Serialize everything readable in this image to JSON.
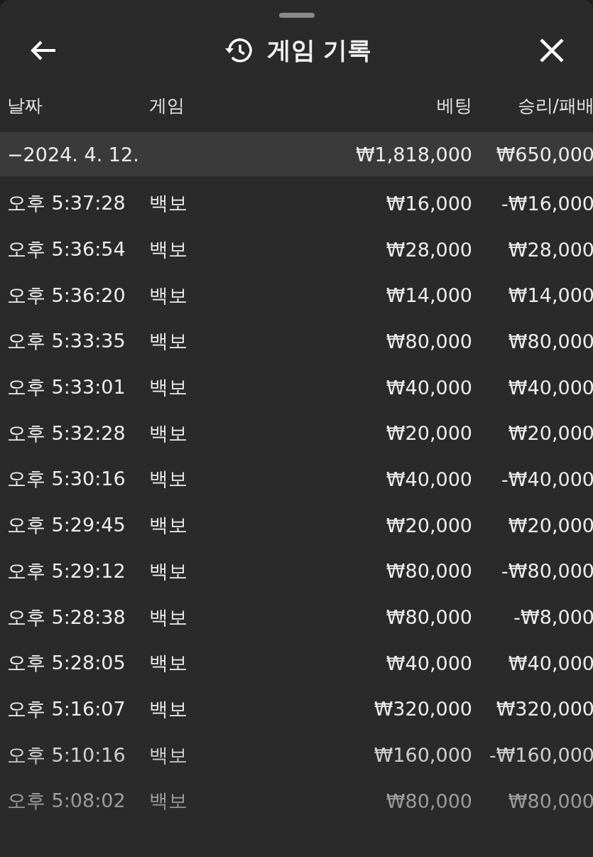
{
  "header": {
    "title": "게임 기록"
  },
  "columns": [
    "날짜",
    "게임",
    "베팅",
    "승리/패배"
  ],
  "group": {
    "toggle": "−",
    "date": "2024. 4. 12.",
    "bet": "₩1,818,000",
    "result": "₩650,000"
  },
  "rows": [
    {
      "time": "오후 5:37:28",
      "game": "백보",
      "bet": "₩16,000",
      "result": "-₩16,000"
    },
    {
      "time": "오후 5:36:54",
      "game": "백보",
      "bet": "₩28,000",
      "result": "₩28,000"
    },
    {
      "time": "오후 5:36:20",
      "game": "백보",
      "bet": "₩14,000",
      "result": "₩14,000"
    },
    {
      "time": "오후 5:33:35",
      "game": "백보",
      "bet": "₩80,000",
      "result": "₩80,000"
    },
    {
      "time": "오후 5:33:01",
      "game": "백보",
      "bet": "₩40,000",
      "result": "₩40,000"
    },
    {
      "time": "오후 5:32:28",
      "game": "백보",
      "bet": "₩20,000",
      "result": "₩20,000"
    },
    {
      "time": "오후 5:30:16",
      "game": "백보",
      "bet": "₩40,000",
      "result": "-₩40,000"
    },
    {
      "time": "오후 5:29:45",
      "game": "백보",
      "bet": "₩20,000",
      "result": "₩20,000"
    },
    {
      "time": "오후 5:29:12",
      "game": "백보",
      "bet": "₩80,000",
      "result": "-₩80,000"
    },
    {
      "time": "오후 5:28:38",
      "game": "백보",
      "bet": "₩80,000",
      "result": "-₩8,000"
    },
    {
      "time": "오후 5:28:05",
      "game": "백보",
      "bet": "₩40,000",
      "result": "₩40,000"
    },
    {
      "time": "오후 5:16:07",
      "game": "백보",
      "bet": "₩320,000",
      "result": "₩320,000"
    },
    {
      "time": "오후 5:10:16",
      "game": "백보",
      "bet": "₩160,000",
      "result": "-₩160,000"
    },
    {
      "time": "오후 5:08:02",
      "game": "백보",
      "bet": "₩80,000",
      "result": "₩80,000"
    }
  ]
}
